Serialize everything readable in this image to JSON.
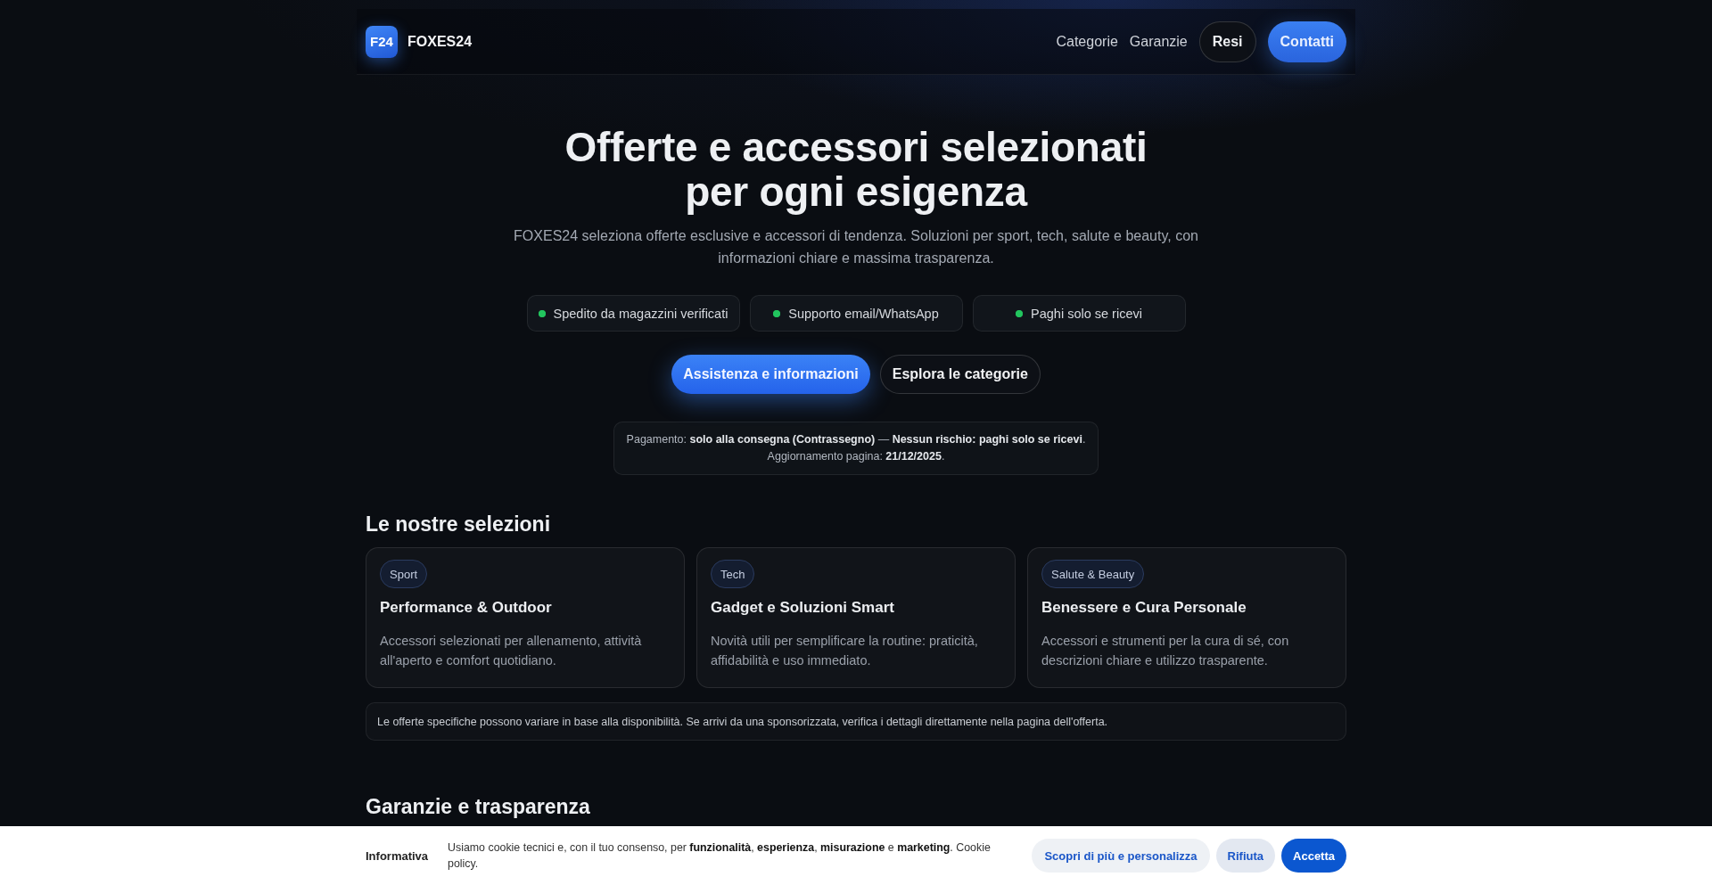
{
  "header": {
    "logo": {
      "mark": "F24",
      "name": "FOXES24"
    },
    "nav": [
      {
        "label": "Categorie",
        "kind": "link"
      },
      {
        "label": "Garanzie",
        "kind": "link"
      },
      {
        "label": "Resi",
        "kind": "outline"
      },
      {
        "label": "Contatti",
        "kind": "primary"
      }
    ]
  },
  "hero": {
    "title": "Offerte e accessori selezionati per ogni esigenza",
    "subtitle": "FOXES24 seleziona offerte esclusive e accessori di tendenza. Soluzioni per sport, tech, salute e beauty, con informazioni chiare e massima trasparenza.",
    "features": [
      {
        "label": "Spedito da magazzini verificati"
      },
      {
        "label": "Supporto email/WhatsApp"
      },
      {
        "label": "Paghi solo se ricevi"
      }
    ],
    "actions": [
      {
        "label": "Assistenza e informazioni",
        "kind": "primary"
      },
      {
        "label": "Esplora le categorie",
        "kind": "outline"
      }
    ],
    "notice": {
      "lines": [
        "Pagamento: **solo alla consegna (Contrassegno)** — **Nessun rischio: paghi solo se ricevi**.",
        "Aggiornamento pagina: **21/12/2025**."
      ]
    }
  },
  "selections": {
    "heading": "Le nostre selezioni",
    "cards": [
      {
        "tag": "Sport",
        "title": "Performance & Outdoor",
        "description": "Accessori selezionati per allenamento, attività all'aperto e comfort quotidiano."
      },
      {
        "tag": "Tech",
        "title": "Gadget e Soluzioni Smart",
        "description": "Novità utili per semplificare la routine: praticità, affidabilità e uso immediato."
      },
      {
        "tag": "Salute & Beauty",
        "title": "Benessere e Cura Personale",
        "description": "Accessori e strumenti per la cura di sé, con descrizioni chiare e utilizzo trasparente."
      }
    ],
    "disclaimer": "Le offerte specifiche possono variare in base alla disponibilità. Se arrivi da una sponsorizzata, verifica i dettagli direttamente nella pagina dell'offerta."
  },
  "guarantees": {
    "heading": "Garanzie e trasparenza"
  },
  "cookie_banner": {
    "title": "Informativa",
    "text": "Usiamo cookie tecnici e, con il tuo consenso, per **funzionalità**, **esperienza**, **misurazione** e **marketing**. Cookie policy.",
    "buttons": [
      {
        "label": "Scopri di più e personalizza",
        "kind": "secondary"
      },
      {
        "label": "Rifiuta",
        "kind": "tertiary"
      },
      {
        "label": "Accetta",
        "kind": "primary"
      }
    ]
  }
}
